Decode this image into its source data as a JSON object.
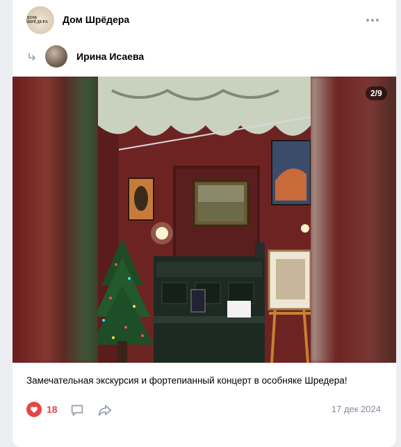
{
  "post": {
    "group_name": "Дом Шрёдера",
    "group_avatar_text": "ДОМ ШРЁДЕРА",
    "author_name": "Ирина Исаева",
    "photo_counter": "2/9",
    "caption": "Замечательная экскурсия и фортепианный концерт в особняке Шредера!",
    "likes": "18",
    "date": "17 дек 2024"
  },
  "icons": {
    "more": "more-horizontal-icon",
    "repost": "repost-icon",
    "like": "heart-icon",
    "comment": "comment-icon",
    "share": "share-icon"
  },
  "colors": {
    "like_active": "#e64646",
    "secondary_text": "#818c99",
    "icon_gray": "#99a2ad"
  }
}
